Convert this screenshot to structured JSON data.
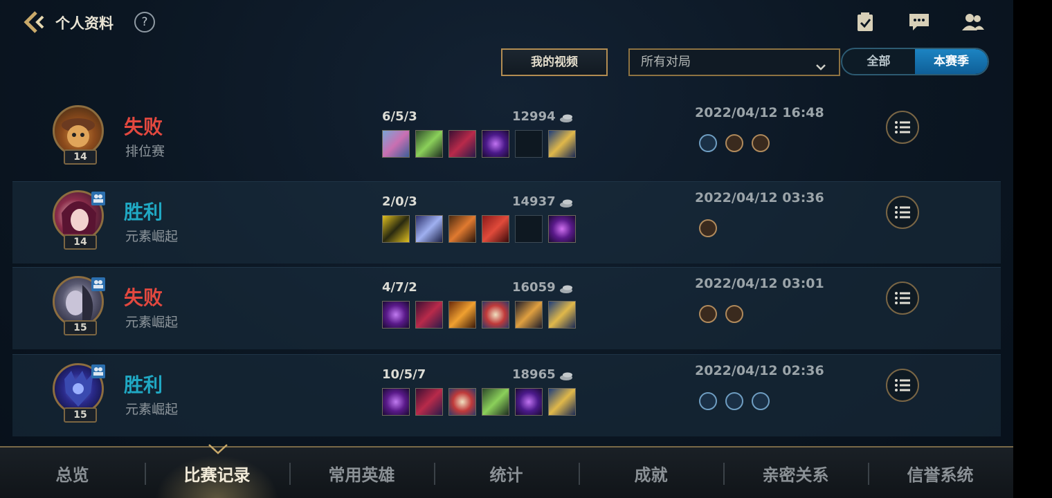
{
  "header": {
    "title": "个人资料",
    "help": "?"
  },
  "filters": {
    "my_videos": "我的视频",
    "match_filter": "所有对局",
    "toggle_all": "全部",
    "toggle_season": "本赛季",
    "toggle_selected": "本赛季"
  },
  "matches": [
    {
      "result": "失败",
      "mode": "排位赛",
      "level": "14",
      "kda": "6/5/3",
      "gold": "12994",
      "date": "2022/04/12 16:48"
    },
    {
      "result": "胜利",
      "mode": "元素崛起",
      "level": "14",
      "kda": "2/0/3",
      "gold": "14937",
      "date": "2022/04/12 03:36"
    },
    {
      "result": "失败",
      "mode": "元素崛起",
      "level": "15",
      "kda": "4/7/2",
      "gold": "16059",
      "date": "2022/04/12 03:01"
    },
    {
      "result": "胜利",
      "mode": "元素崛起",
      "level": "15",
      "kda": "10/5/7",
      "gold": "18965",
      "date": "2022/04/12 02:36"
    }
  ],
  "nav": {
    "tabs": [
      "总览",
      "比赛记录",
      "常用英雄",
      "统计",
      "成就",
      "亲密关系",
      "信誉系统"
    ],
    "active": "比赛记录"
  },
  "icons": [
    "back-arrow-icon",
    "help-icon",
    "tasks-icon",
    "chat-icon",
    "friends-icon",
    "caret-down-icon",
    "gold-icon",
    "list-icon",
    "party-icon"
  ],
  "colors": {
    "loss": "#e2483f",
    "win": "#20a8c3",
    "gold_border": "#b38d52",
    "toggle_active": "#1c84c2"
  }
}
